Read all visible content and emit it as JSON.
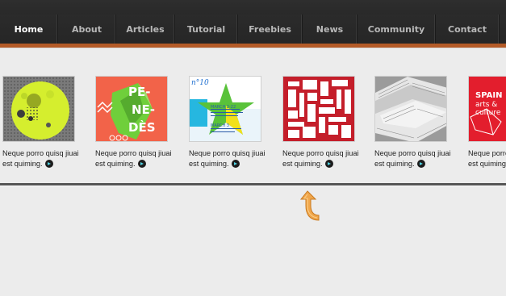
{
  "nav": {
    "items": [
      {
        "label": "Home",
        "active": true
      },
      {
        "label": "About",
        "active": false
      },
      {
        "label": "Articles",
        "active": false
      },
      {
        "label": "Tutorial",
        "active": false
      },
      {
        "label": "Freebies",
        "active": false
      },
      {
        "label": "News",
        "active": false
      },
      {
        "label": "Community",
        "active": false
      },
      {
        "label": "Contact",
        "active": false
      }
    ]
  },
  "colors": {
    "accent": "#b35a27",
    "nav_bg": "#262626",
    "arrow": "#f0a64b"
  },
  "carousel": {
    "items": [
      {
        "thumb": "yellow-circle-poster",
        "caption_line1": "Neque porro quisq jiuai",
        "caption_line2": "est quiming."
      },
      {
        "thumb": "penedes-poster",
        "thumb_text": "PE-\nNE-\nDÈS",
        "caption_line1": "Neque porro quisq jiuai",
        "caption_line2": "est quiming."
      },
      {
        "thumb": "star-poster",
        "thumb_text_top": "n°10",
        "thumb_text_a": "MARCH 2-22",
        "thumb_text_b": "MARCH 3",
        "caption_line1": "Neque porro quisq jiuai",
        "caption_line2": "est quiming."
      },
      {
        "thumb": "typography-poster",
        "caption_line1": "Neque porro quisq jiuai",
        "caption_line2": "est quiming."
      },
      {
        "thumb": "newspapers-photo",
        "caption_line1": "Neque porro quisq jiuai",
        "caption_line2": "est quiming."
      },
      {
        "thumb": "spain-poster",
        "thumb_text": "SPAIN\narts &\nculture",
        "caption_line1": "Neque porro",
        "caption_line2": "est quiming."
      }
    ]
  },
  "back_icon": "curved-arrow-icon"
}
